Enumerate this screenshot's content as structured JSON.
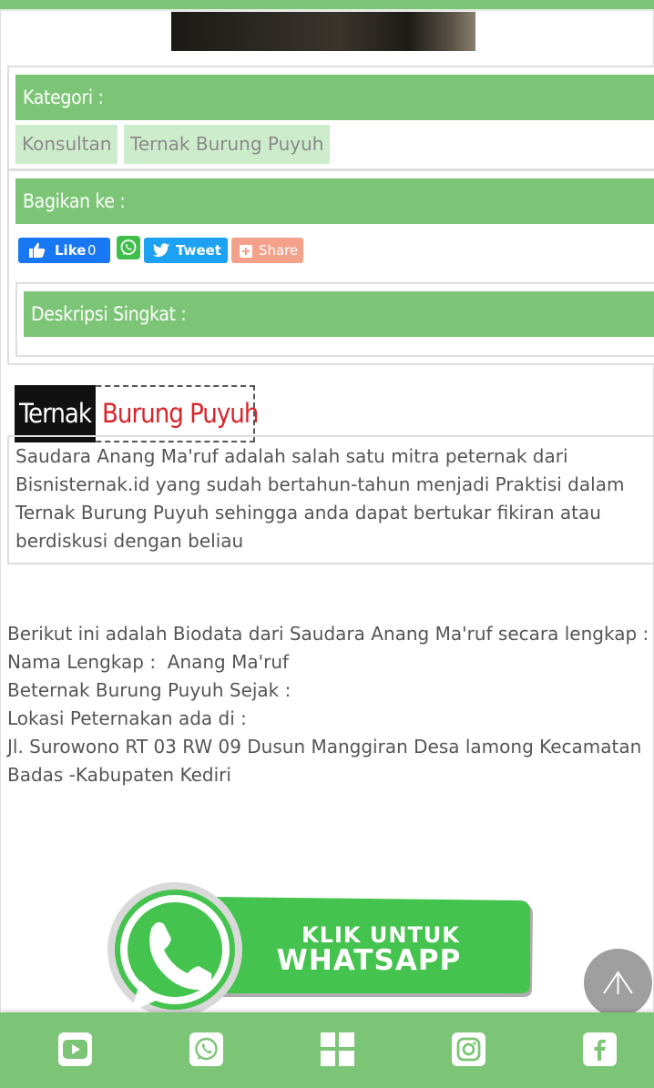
{
  "categories_heading": "Kategori :",
  "category_tags": [
    "Konsultan",
    "Ternak Burung Puyuh"
  ],
  "share_heading": "Bagikan ke :",
  "share_buttons": {
    "facebook_like": "Like",
    "facebook_count": "0",
    "tweet": "Tweet",
    "share": "Share"
  },
  "description_heading": "Deskripsi Singkat :",
  "title": {
    "part1": "Ternak",
    "part2": "Burung Puyuh"
  },
  "intro_lines": [
    "Saudara Anang Ma'ruf adalah salah satu mitra peternak dari",
    "Bisnisternak.id yang sudah bertahun-tahun menjadi Praktisi dalam",
    "Ternak Burung Puyuh sehingga anda dapat bertukar fikiran atau",
    "berdiskusi dengan beliau"
  ],
  "bio_lines": [
    "Berikut ini adalah Biodata dari Saudara Anang Ma'ruf secara lengkap :",
    "Nama Lengkap :  Anang Ma'ruf",
    "Beternak Burung Puyuh Sejak :",
    "Lokasi Peternakan ada di :",
    "Jl. Surowono RT 03 RW 09 Dusun Manggiran Desa lamong Kecamatan",
    "Badas -Kabupaten Kediri"
  ],
  "whatsapp_banner": {
    "line1": "KLIK UNTUK",
    "line2": "WHATSAPP"
  },
  "colors": {
    "green": "#7cc576",
    "tag_bg": "#cdeccb",
    "title_red": "#d9252a",
    "banner_green": "#44c34e"
  },
  "bottom_nav_icons": [
    "youtube-icon",
    "whatsapp-icon",
    "menu-grid-icon",
    "instagram-icon",
    "facebook-icon"
  ]
}
